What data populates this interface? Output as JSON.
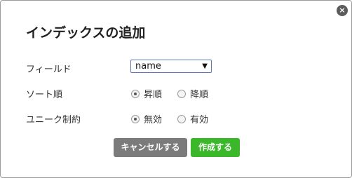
{
  "dialog": {
    "title": "インデックスの追加",
    "close_icon": "×"
  },
  "field_row": {
    "label": "フィールド",
    "select_value": "name",
    "arrow": "▼"
  },
  "sort_row": {
    "label": "ソート順",
    "options": [
      {
        "label": "昇順",
        "checked": true
      },
      {
        "label": "降順",
        "checked": false
      }
    ]
  },
  "unique_row": {
    "label": "ユニーク制約",
    "options": [
      {
        "label": "無効",
        "checked": true
      },
      {
        "label": "有効",
        "checked": false
      }
    ]
  },
  "buttons": {
    "cancel": "キャンセルする",
    "create": "作成する"
  },
  "colors": {
    "create_button": "#3bb82a",
    "cancel_button": "#7b7b7b",
    "select_border": "#5a7ab8"
  }
}
